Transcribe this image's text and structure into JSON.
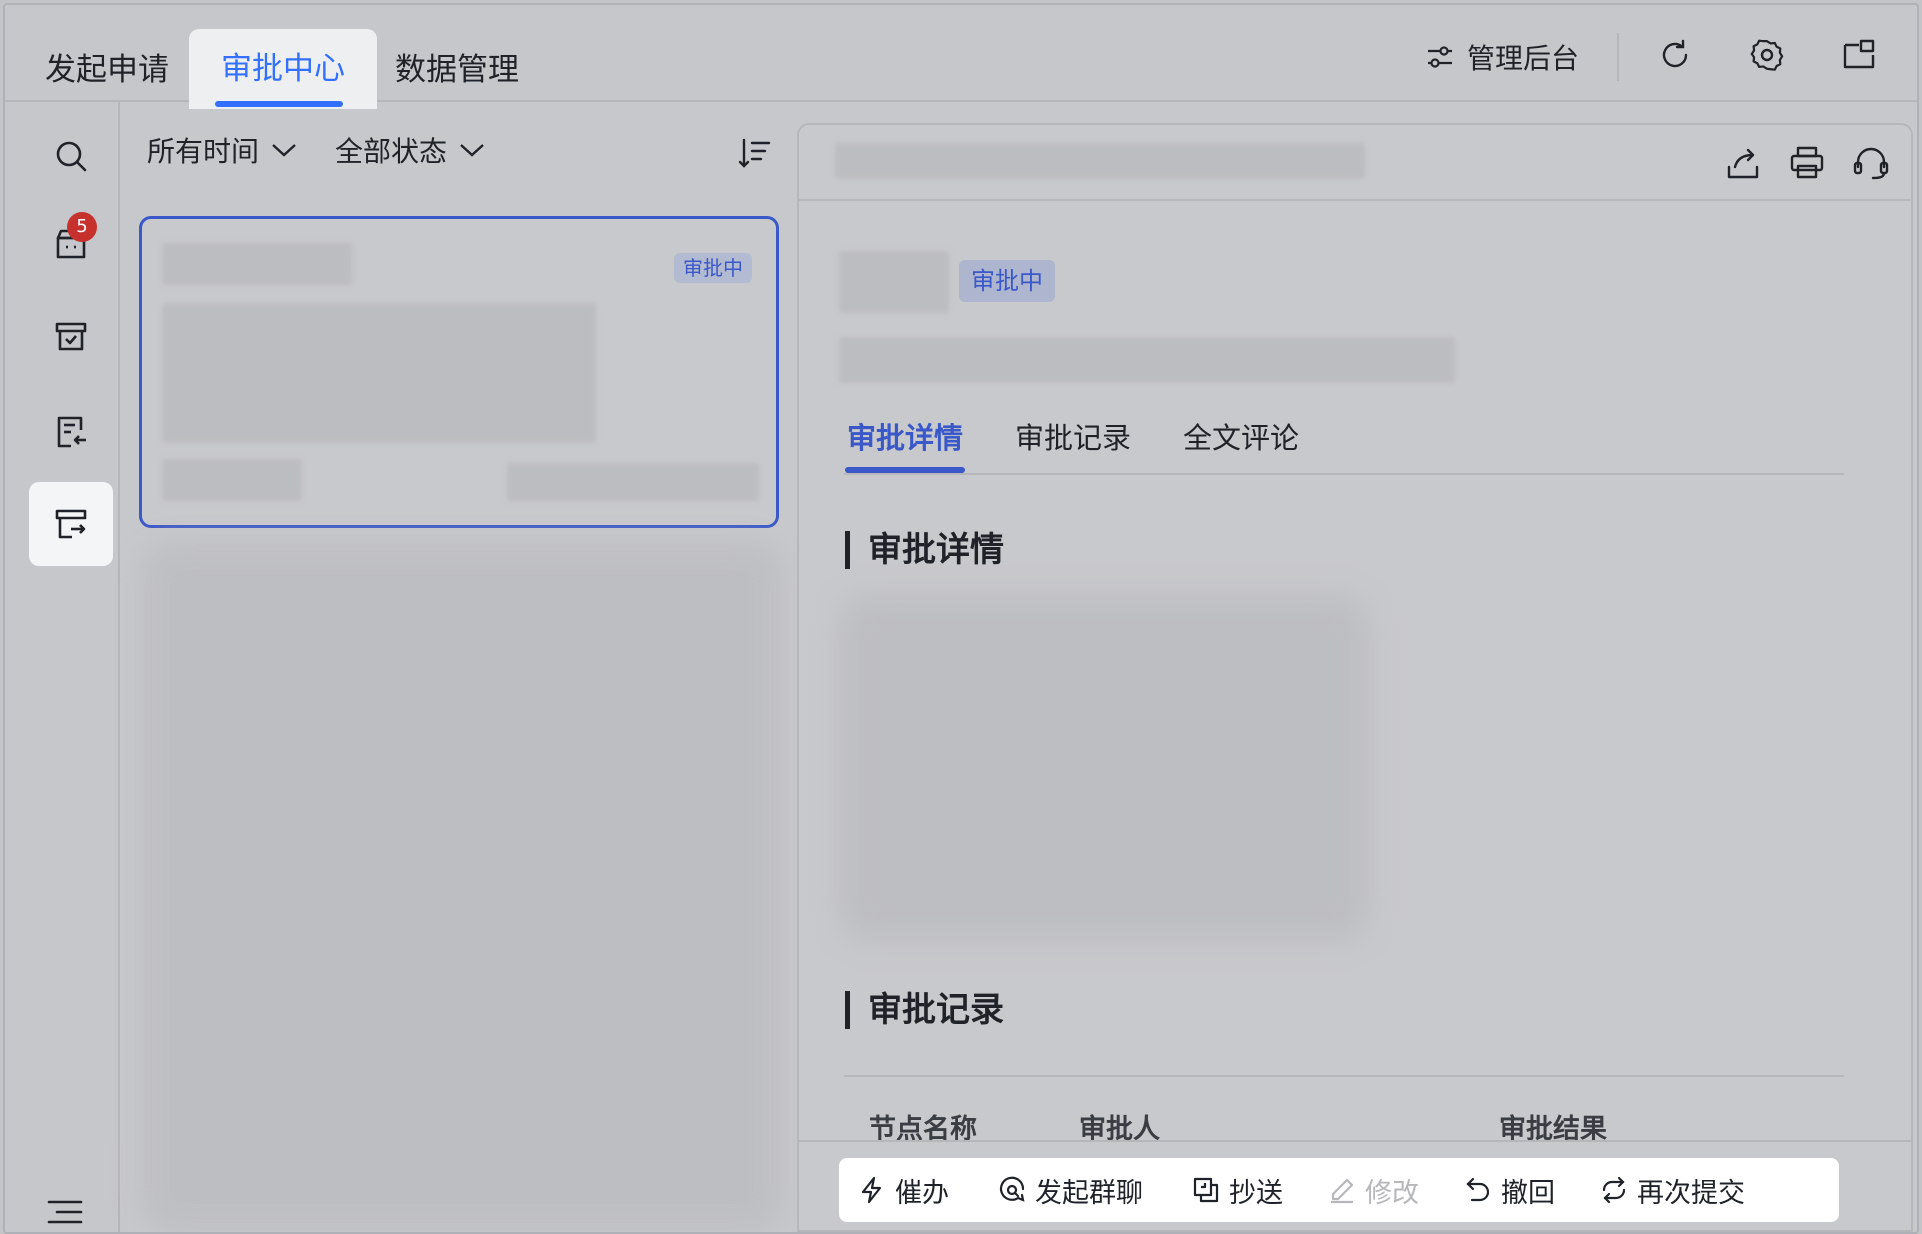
{
  "top_tabs": [
    {
      "label": "发起申请"
    },
    {
      "label": "审批中心"
    },
    {
      "label": "数据管理"
    }
  ],
  "top_right": {
    "admin_label": "管理后台"
  },
  "rail": {
    "badge_count": "5"
  },
  "filters": {
    "time": "所有时间",
    "status": "全部状态"
  },
  "card": {
    "status": "审批中"
  },
  "detail": {
    "status": "审批中",
    "tabs": [
      {
        "label": "审批详情"
      },
      {
        "label": "审批记录"
      },
      {
        "label": "全文评论"
      }
    ],
    "section_details": "审批详情",
    "section_records": "审批记录",
    "columns": {
      "node": "节点名称",
      "approver": "审批人",
      "result": "审批结果"
    }
  },
  "actions": [
    {
      "label": "催办"
    },
    {
      "label": "发起群聊"
    },
    {
      "label": "抄送"
    },
    {
      "label": "修改"
    },
    {
      "label": "撤回"
    },
    {
      "label": "再次提交"
    }
  ],
  "colors": {
    "accent": "#3370ff",
    "status_blue": "#3a58c8",
    "badge_red": "#c7312d"
  }
}
